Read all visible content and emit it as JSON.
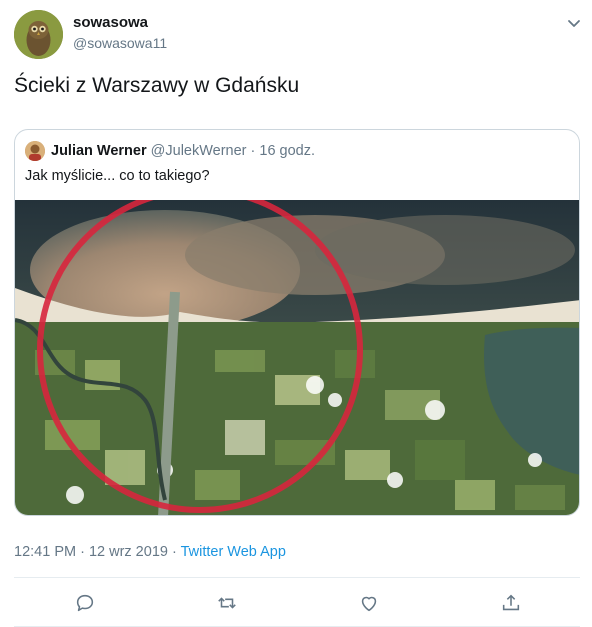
{
  "tweet": {
    "author_name": "sowasowa",
    "author_handle": "@sowasowa11",
    "text": "Ścieki z Warszawy w Gdańsku"
  },
  "quoted_tweet": {
    "author_name": "Julian Werner",
    "author_meta": "@JulekWerner · 16 godz.",
    "text": "Jak myślicie... co to takiego?"
  },
  "footer": {
    "timestamp": "12:41 PM · 12 wrz 2019 · ",
    "source": "Twitter Web App"
  },
  "icons": {
    "menu": "chevron-down-icon",
    "reply": "reply-icon",
    "retweet": "retweet-icon",
    "like": "like-icon",
    "share": "share-icon"
  },
  "colors": {
    "link": "#1b95e0",
    "secondary_text": "#657786",
    "highlight_circle": "#d7263d"
  }
}
